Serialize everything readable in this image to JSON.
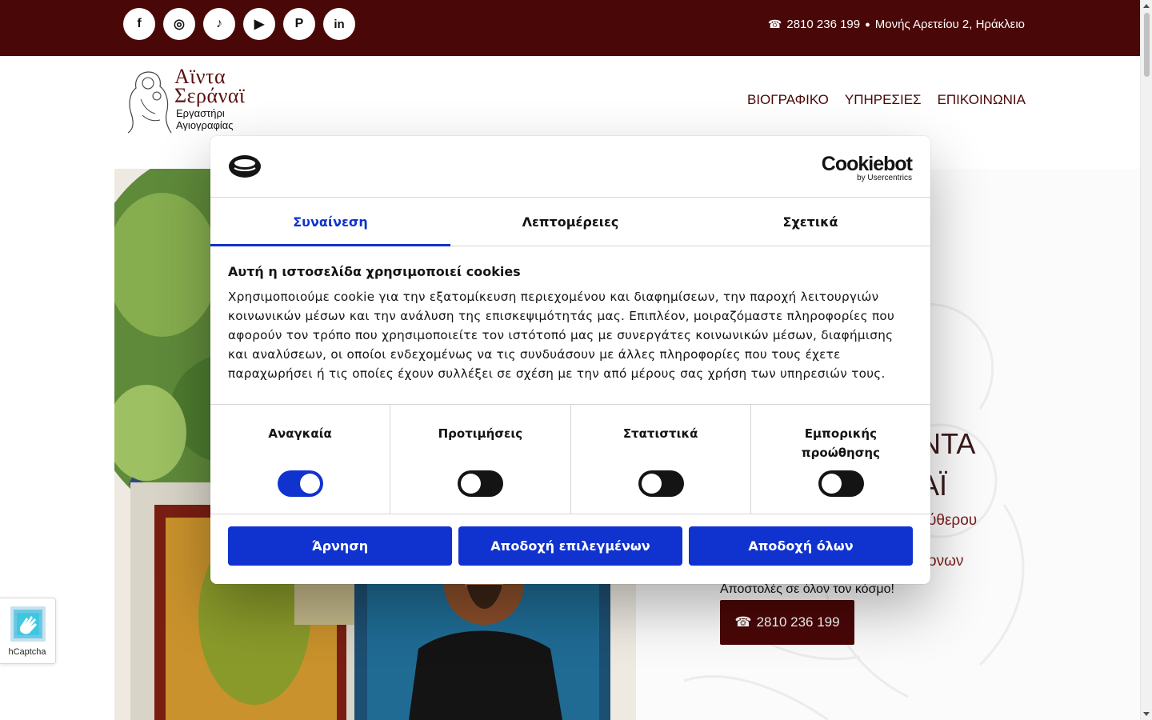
{
  "topbar": {
    "social": [
      {
        "name": "facebook-icon",
        "glyph": "f"
      },
      {
        "name": "instagram-icon",
        "glyph": "◎"
      },
      {
        "name": "tiktok-icon",
        "glyph": "♪"
      },
      {
        "name": "youtube-icon",
        "glyph": "▶"
      },
      {
        "name": "pinterest-icon",
        "glyph": "P"
      },
      {
        "name": "linkedin-icon",
        "glyph": "in"
      }
    ],
    "phone_icon": "☎",
    "phone": "2810 236 199",
    "location_icon": "●",
    "address": "Μονής Αρετείου 2, Ηράκλειο",
    "bar_color": "#4a0707"
  },
  "header": {
    "logo_name_line1": "Αϊντα",
    "logo_name_line2": "Σεράναϊ",
    "logo_sub_line1": "Εργαστήρι",
    "logo_sub_line2": "Αγιογραφίας",
    "nav": [
      "ΒΙΟΓΡΑΦΙΚΟ",
      "ΥΠΗΡΕΣΙΕΣ",
      "ΕΠΙΚΟΙΝΩΝΙΑ"
    ]
  },
  "hero": {
    "title_line1": "ΝΤΑ",
    "title_line2": "ΑΪ",
    "sub_line1": "ύθερου",
    "sub_line2": "ονων",
    "shipping": "Αποστολές σε όλον τον κόσμο!",
    "call_icon": "☎",
    "call_label": "2810 236 199"
  },
  "hcaptcha": {
    "label": "hCaptcha"
  },
  "cookie": {
    "brand": "Cookiebot",
    "brand_by": "by Usercentrics",
    "tabs": [
      "Συναίνεση",
      "Λεπτομέρειες",
      "Σχετικά"
    ],
    "active_tab": 0,
    "heading": "Αυτή η ιστοσελίδα χρησιμοποιεί cookies",
    "text": "Χρησιμοποιούμε cookie για την εξατομίκευση περιεχομένου και διαφημίσεων, την παροχή λειτουργιών κοινωνικών μέσων και την ανάλυση της επισκεψιμότητάς μας. Επιπλέον, μοιραζόμαστε πληροφορίες που αφορούν τον τρόπο που χρησιμοποιείτε τον ιστότοπό μας με συνεργάτες κοινωνικών μέσων, διαφήμισης και αναλύσεων, οι οποίοι ενδεχομένως να τις συνδυάσουν με άλλες πληροφορίες που τους έχετε παραχωρήσει ή τις οποίες έχουν συλλέξει σε σχέση με την από μέρους σας χρήση των υπηρεσιών τους.",
    "switches": [
      {
        "label": "Αναγκαία",
        "on": true
      },
      {
        "label": "Προτιμήσεις",
        "on": false
      },
      {
        "label": "Στατιστικά",
        "on": false
      },
      {
        "label": "Εμπορικής προώθησης",
        "on": false
      }
    ],
    "buttons": [
      "Άρνηση",
      "Αποδοχή επιλεγμένων",
      "Αποδοχή όλων"
    ],
    "accent": "#1032cf"
  }
}
